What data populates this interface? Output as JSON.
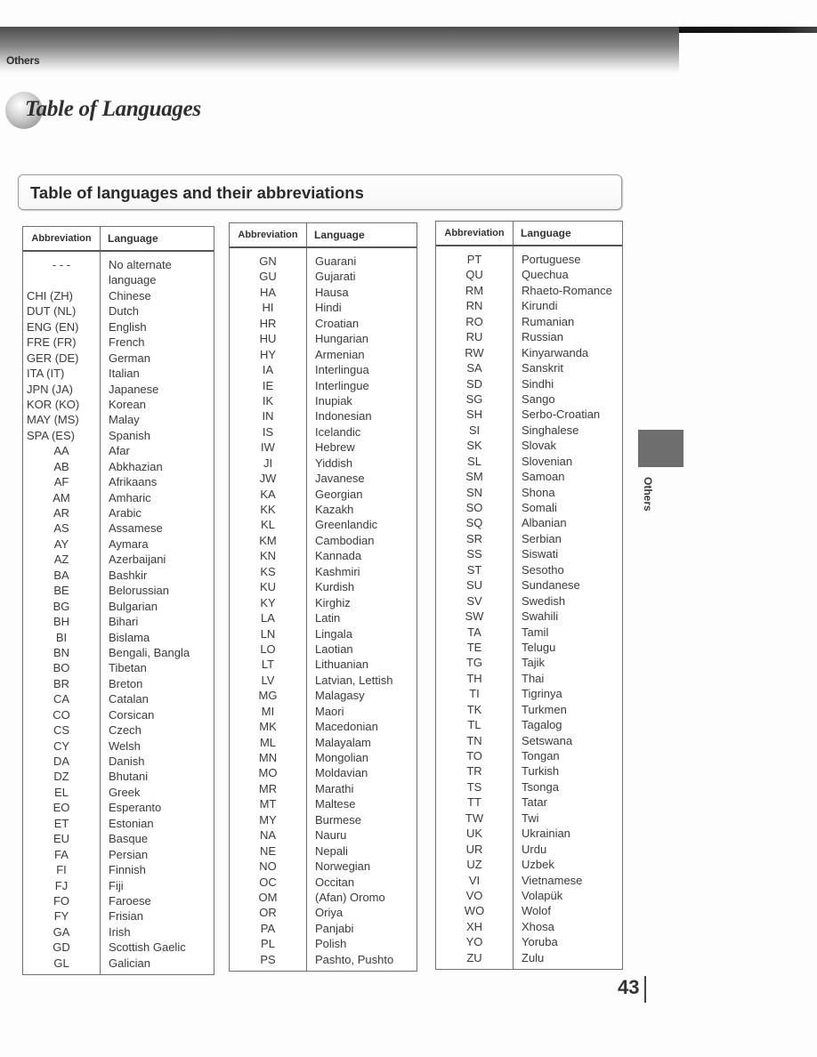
{
  "header": {
    "section_label": "Others",
    "page_title": "Table of Languages"
  },
  "subtitle": "Table of languages and their abbreviations",
  "table_headers": {
    "abbreviation": "Abbreviation",
    "language": "Language"
  },
  "tables": [
    {
      "rows": [
        {
          "abbr": "- - -",
          "lang": "No alternate"
        },
        {
          "abbr": "",
          "lang": "language"
        },
        {
          "abbr": "CHI (ZH)",
          "lang": "Chinese"
        },
        {
          "abbr": "DUT (NL)",
          "lang": "Dutch"
        },
        {
          "abbr": "ENG (EN)",
          "lang": "English"
        },
        {
          "abbr": "FRE (FR)",
          "lang": "French"
        },
        {
          "abbr": "GER (DE)",
          "lang": "German"
        },
        {
          "abbr": "ITA (IT)",
          "lang": "Italian"
        },
        {
          "abbr": "JPN (JA)",
          "lang": "Japanese"
        },
        {
          "abbr": "KOR (KO)",
          "lang": "Korean"
        },
        {
          "abbr": "MAY (MS)",
          "lang": "Malay"
        },
        {
          "abbr": "SPA (ES)",
          "lang": "Spanish"
        },
        {
          "abbr": "AA",
          "lang": "Afar"
        },
        {
          "abbr": "AB",
          "lang": "Abkhazian"
        },
        {
          "abbr": "AF",
          "lang": "Afrikaans"
        },
        {
          "abbr": "AM",
          "lang": "Amharic"
        },
        {
          "abbr": "AR",
          "lang": "Arabic"
        },
        {
          "abbr": "AS",
          "lang": "Assamese"
        },
        {
          "abbr": "AY",
          "lang": "Aymara"
        },
        {
          "abbr": "AZ",
          "lang": "Azerbaijani"
        },
        {
          "abbr": "BA",
          "lang": "Bashkir"
        },
        {
          "abbr": "BE",
          "lang": "Belorussian"
        },
        {
          "abbr": "BG",
          "lang": "Bulgarian"
        },
        {
          "abbr": "BH",
          "lang": "Bihari"
        },
        {
          "abbr": "BI",
          "lang": "Bislama"
        },
        {
          "abbr": "BN",
          "lang": "Bengali, Bangla"
        },
        {
          "abbr": "BO",
          "lang": "Tibetan"
        },
        {
          "abbr": "BR",
          "lang": "Breton"
        },
        {
          "abbr": "CA",
          "lang": "Catalan"
        },
        {
          "abbr": "CO",
          "lang": "Corsican"
        },
        {
          "abbr": "CS",
          "lang": "Czech"
        },
        {
          "abbr": "CY",
          "lang": "Welsh"
        },
        {
          "abbr": "DA",
          "lang": "Danish"
        },
        {
          "abbr": "DZ",
          "lang": "Bhutani"
        },
        {
          "abbr": "EL",
          "lang": "Greek"
        },
        {
          "abbr": "EO",
          "lang": "Esperanto"
        },
        {
          "abbr": "ET",
          "lang": "Estonian"
        },
        {
          "abbr": "EU",
          "lang": "Basque"
        },
        {
          "abbr": "FA",
          "lang": "Persian"
        },
        {
          "abbr": "FI",
          "lang": "Finnish"
        },
        {
          "abbr": "FJ",
          "lang": "Fiji"
        },
        {
          "abbr": "FO",
          "lang": "Faroese"
        },
        {
          "abbr": "FY",
          "lang": "Frisian"
        },
        {
          "abbr": "GA",
          "lang": "Irish"
        },
        {
          "abbr": "GD",
          "lang": "Scottish Gaelic"
        },
        {
          "abbr": "GL",
          "lang": "Galician"
        }
      ]
    },
    {
      "rows": [
        {
          "abbr": "GN",
          "lang": "Guarani"
        },
        {
          "abbr": "GU",
          "lang": "Gujarati"
        },
        {
          "abbr": "HA",
          "lang": "Hausa"
        },
        {
          "abbr": "HI",
          "lang": "Hindi"
        },
        {
          "abbr": "HR",
          "lang": "Croatian"
        },
        {
          "abbr": "HU",
          "lang": "Hungarian"
        },
        {
          "abbr": "HY",
          "lang": "Armenian"
        },
        {
          "abbr": "IA",
          "lang": "Interlingua"
        },
        {
          "abbr": "IE",
          "lang": "Interlingue"
        },
        {
          "abbr": "IK",
          "lang": "Inupiak"
        },
        {
          "abbr": "IN",
          "lang": "Indonesian"
        },
        {
          "abbr": "IS",
          "lang": "Icelandic"
        },
        {
          "abbr": "IW",
          "lang": "Hebrew"
        },
        {
          "abbr": "JI",
          "lang": "Yiddish"
        },
        {
          "abbr": "JW",
          "lang": "Javanese"
        },
        {
          "abbr": "KA",
          "lang": "Georgian"
        },
        {
          "abbr": "KK",
          "lang": "Kazakh"
        },
        {
          "abbr": "KL",
          "lang": "Greenlandic"
        },
        {
          "abbr": "KM",
          "lang": "Cambodian"
        },
        {
          "abbr": "KN",
          "lang": "Kannada"
        },
        {
          "abbr": "KS",
          "lang": "Kashmiri"
        },
        {
          "abbr": "KU",
          "lang": "Kurdish"
        },
        {
          "abbr": "KY",
          "lang": "Kirghiz"
        },
        {
          "abbr": "LA",
          "lang": "Latin"
        },
        {
          "abbr": "LN",
          "lang": "Lingala"
        },
        {
          "abbr": "LO",
          "lang": "Laotian"
        },
        {
          "abbr": "LT",
          "lang": "Lithuanian"
        },
        {
          "abbr": "LV",
          "lang": "Latvian, Lettish"
        },
        {
          "abbr": "MG",
          "lang": "Malagasy"
        },
        {
          "abbr": "MI",
          "lang": "Maori"
        },
        {
          "abbr": "MK",
          "lang": "Macedonian"
        },
        {
          "abbr": "ML",
          "lang": "Malayalam"
        },
        {
          "abbr": "MN",
          "lang": "Mongolian"
        },
        {
          "abbr": "MO",
          "lang": "Moldavian"
        },
        {
          "abbr": "MR",
          "lang": "Marathi"
        },
        {
          "abbr": "MT",
          "lang": "Maltese"
        },
        {
          "abbr": "MY",
          "lang": "Burmese"
        },
        {
          "abbr": "NA",
          "lang": "Nauru"
        },
        {
          "abbr": "NE",
          "lang": "Nepali"
        },
        {
          "abbr": "NO",
          "lang": "Norwegian"
        },
        {
          "abbr": "OC",
          "lang": "Occitan"
        },
        {
          "abbr": "OM",
          "lang": "(Afan) Oromo"
        },
        {
          "abbr": "OR",
          "lang": "Oriya"
        },
        {
          "abbr": "PA",
          "lang": "Panjabi"
        },
        {
          "abbr": "PL",
          "lang": "Polish"
        },
        {
          "abbr": "PS",
          "lang": "Pashto, Pushto"
        }
      ]
    },
    {
      "rows": [
        {
          "abbr": "PT",
          "lang": "Portuguese"
        },
        {
          "abbr": "QU",
          "lang": "Quechua"
        },
        {
          "abbr": "RM",
          "lang": "Rhaeto-Romance"
        },
        {
          "abbr": "RN",
          "lang": "Kirundi"
        },
        {
          "abbr": "RO",
          "lang": "Rumanian"
        },
        {
          "abbr": "RU",
          "lang": "Russian"
        },
        {
          "abbr": "RW",
          "lang": "Kinyarwanda"
        },
        {
          "abbr": "SA",
          "lang": "Sanskrit"
        },
        {
          "abbr": "SD",
          "lang": "Sindhi"
        },
        {
          "abbr": "SG",
          "lang": "Sango"
        },
        {
          "abbr": "SH",
          "lang": "Serbo-Croatian"
        },
        {
          "abbr": "SI",
          "lang": "Singhalese"
        },
        {
          "abbr": "SK",
          "lang": "Slovak"
        },
        {
          "abbr": "SL",
          "lang": "Slovenian"
        },
        {
          "abbr": "SM",
          "lang": "Samoan"
        },
        {
          "abbr": "SN",
          "lang": "Shona"
        },
        {
          "abbr": "SO",
          "lang": "Somali"
        },
        {
          "abbr": "SQ",
          "lang": "Albanian"
        },
        {
          "abbr": "SR",
          "lang": "Serbian"
        },
        {
          "abbr": "SS",
          "lang": "Siswati"
        },
        {
          "abbr": "ST",
          "lang": "Sesotho"
        },
        {
          "abbr": "SU",
          "lang": "Sundanese"
        },
        {
          "abbr": "SV",
          "lang": "Swedish"
        },
        {
          "abbr": "SW",
          "lang": "Swahili"
        },
        {
          "abbr": "TA",
          "lang": "Tamil"
        },
        {
          "abbr": "TE",
          "lang": "Telugu"
        },
        {
          "abbr": "TG",
          "lang": "Tajik"
        },
        {
          "abbr": "TH",
          "lang": "Thai"
        },
        {
          "abbr": "TI",
          "lang": "Tigrinya"
        },
        {
          "abbr": "TK",
          "lang": "Turkmen"
        },
        {
          "abbr": "TL",
          "lang": "Tagalog"
        },
        {
          "abbr": "TN",
          "lang": "Setswana"
        },
        {
          "abbr": "TO",
          "lang": "Tongan"
        },
        {
          "abbr": "TR",
          "lang": "Turkish"
        },
        {
          "abbr": "TS",
          "lang": "Tsonga"
        },
        {
          "abbr": "TT",
          "lang": "Tatar"
        },
        {
          "abbr": "TW",
          "lang": "Twi"
        },
        {
          "abbr": "UK",
          "lang": "Ukrainian"
        },
        {
          "abbr": "UR",
          "lang": "Urdu"
        },
        {
          "abbr": "UZ",
          "lang": "Uzbek"
        },
        {
          "abbr": "VI",
          "lang": "Vietnamese"
        },
        {
          "abbr": "VO",
          "lang": "Volapük"
        },
        {
          "abbr": "WO",
          "lang": "Wolof"
        },
        {
          "abbr": "XH",
          "lang": "Xhosa"
        },
        {
          "abbr": "YO",
          "lang": "Yoruba"
        },
        {
          "abbr": "ZU",
          "lang": "Zulu"
        }
      ]
    }
  ],
  "side_tab": {
    "label": "Others",
    "color": "#6e6e6e"
  },
  "page_number": "43"
}
